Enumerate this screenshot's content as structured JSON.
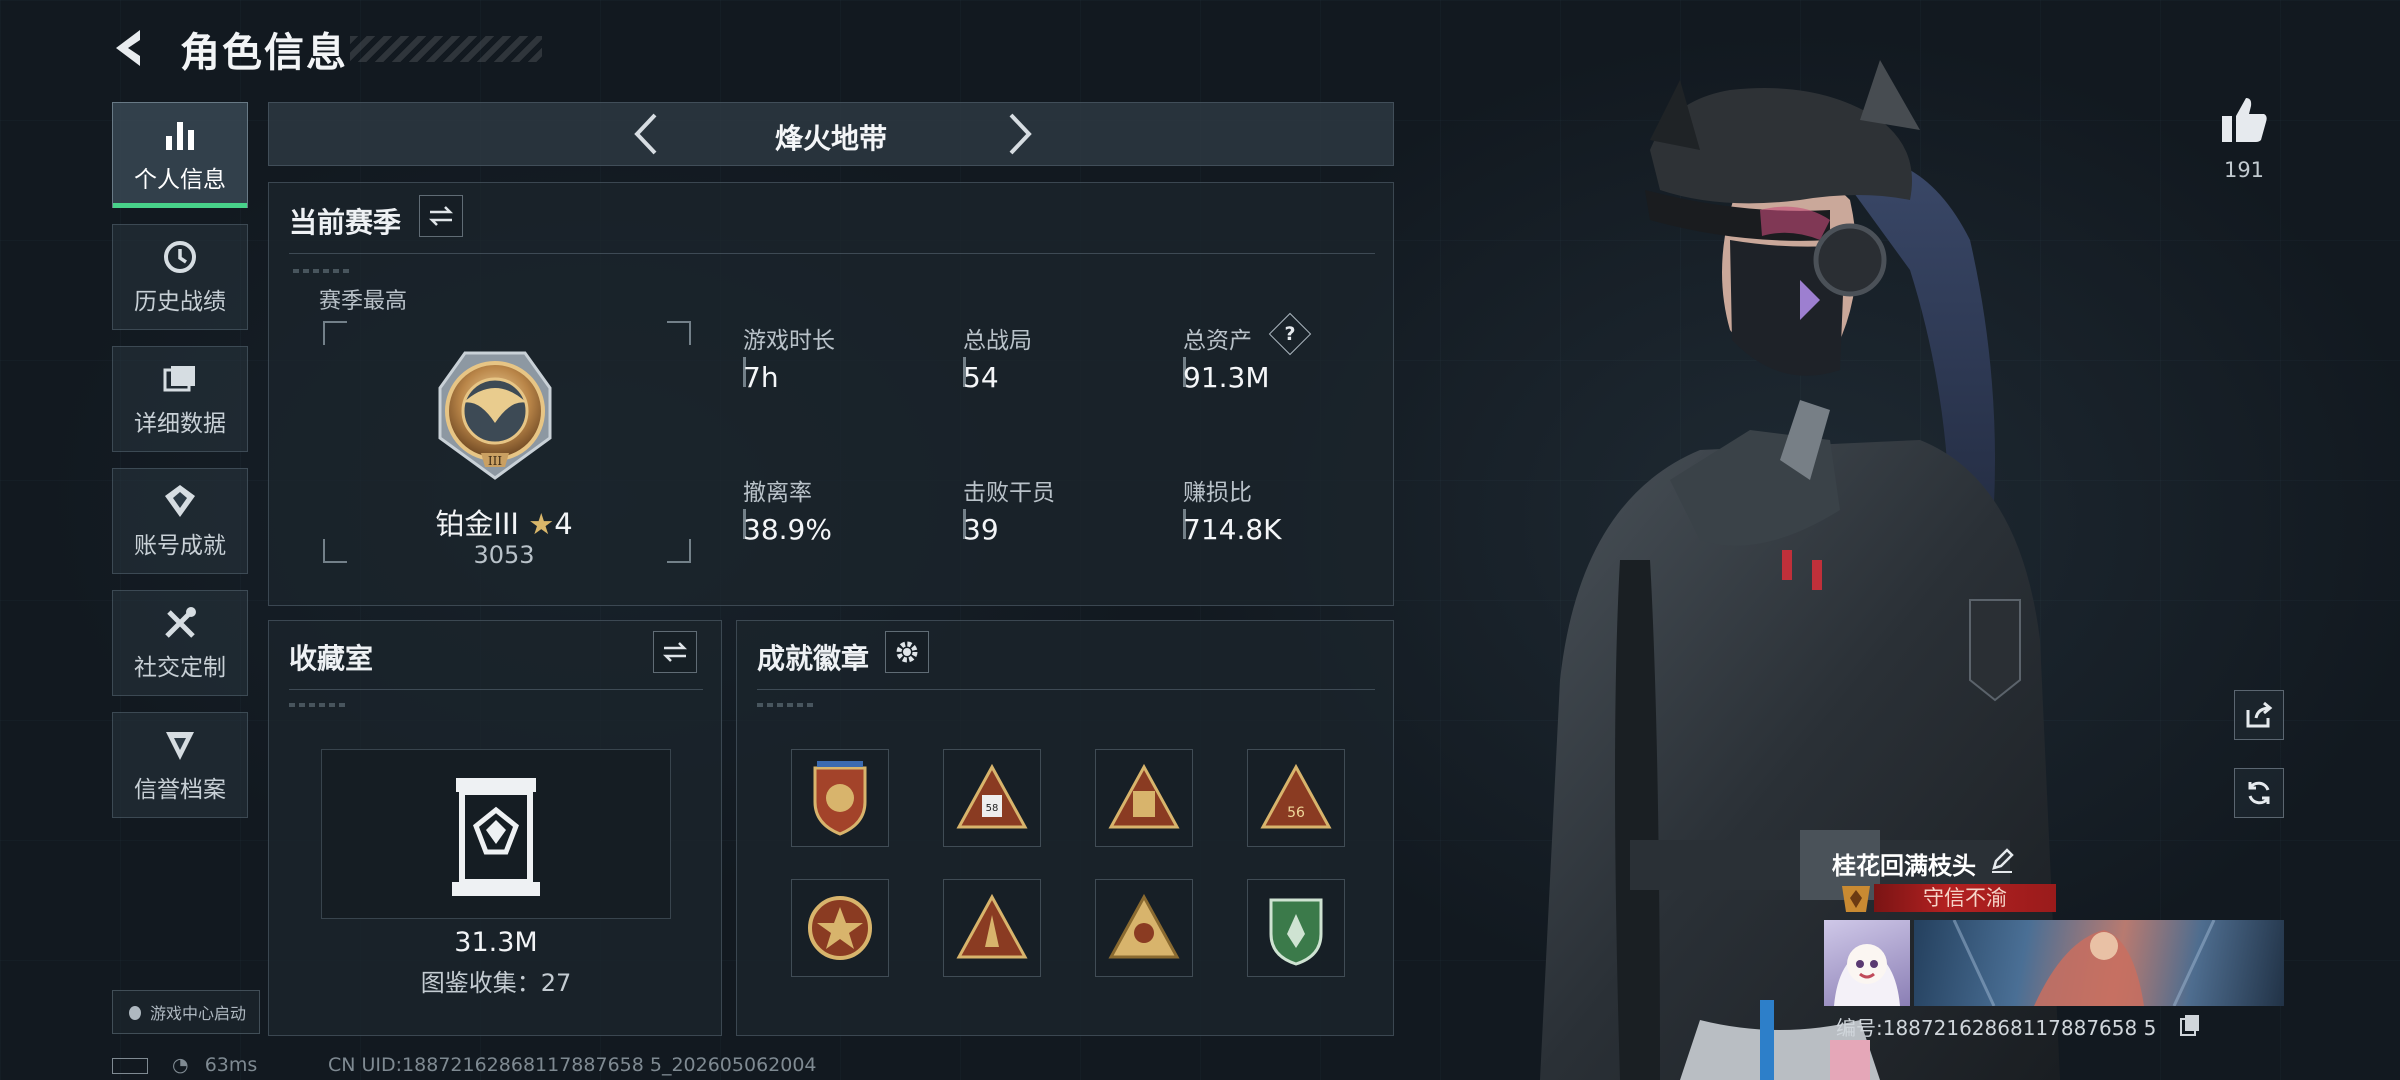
{
  "header": {
    "title": "角色信息"
  },
  "sidebar": {
    "items": [
      {
        "label": "个人信息",
        "icon": "bar-chart-icon",
        "active": true
      },
      {
        "label": "历史战绩",
        "icon": "history-clock-icon"
      },
      {
        "label": "详细数据",
        "icon": "folder-icon"
      },
      {
        "label": "账号成就",
        "icon": "achievement-icon"
      },
      {
        "label": "社交定制",
        "icon": "tools-icon"
      },
      {
        "label": "信誉档案",
        "icon": "reputation-icon"
      }
    ],
    "launch_label": "游戏中心启动"
  },
  "mode": {
    "title": "烽火地带"
  },
  "season": {
    "title": "当前赛季",
    "best_label": "赛季最高",
    "rank": "铂金III",
    "stars": "4",
    "score": "3053",
    "stats": [
      {
        "label": "游戏时长",
        "value": "7h"
      },
      {
        "label": "总战局",
        "value": "54"
      },
      {
        "label": "总资产",
        "value": "91.3M",
        "help": "?"
      },
      {
        "label": "撤离率",
        "value": "38.9%"
      },
      {
        "label": "击败干员",
        "value": "39"
      },
      {
        "label": "赚损比",
        "value": "714.8K"
      }
    ]
  },
  "collection": {
    "title": "收藏室",
    "value": "31.3M",
    "catalog_text": "图鉴收集：27"
  },
  "badges": {
    "title": "成就徽章",
    "items": [
      "badge-1",
      "badge-2",
      "badge-3",
      "badge-4",
      "badge-5",
      "badge-6",
      "badge-7",
      "badge-8"
    ]
  },
  "profile": {
    "likes": "191",
    "nickname": "桂花回满枝头",
    "honor": "守信不渝",
    "uid_text": "编号:18872162868117887658 5"
  },
  "status": {
    "ping": "63ms",
    "cn_uid": "CN UID:18872162868117887658 5_202605062004"
  },
  "colors": {
    "accent_green": "#48d28a",
    "honor_red": "#b32121"
  }
}
